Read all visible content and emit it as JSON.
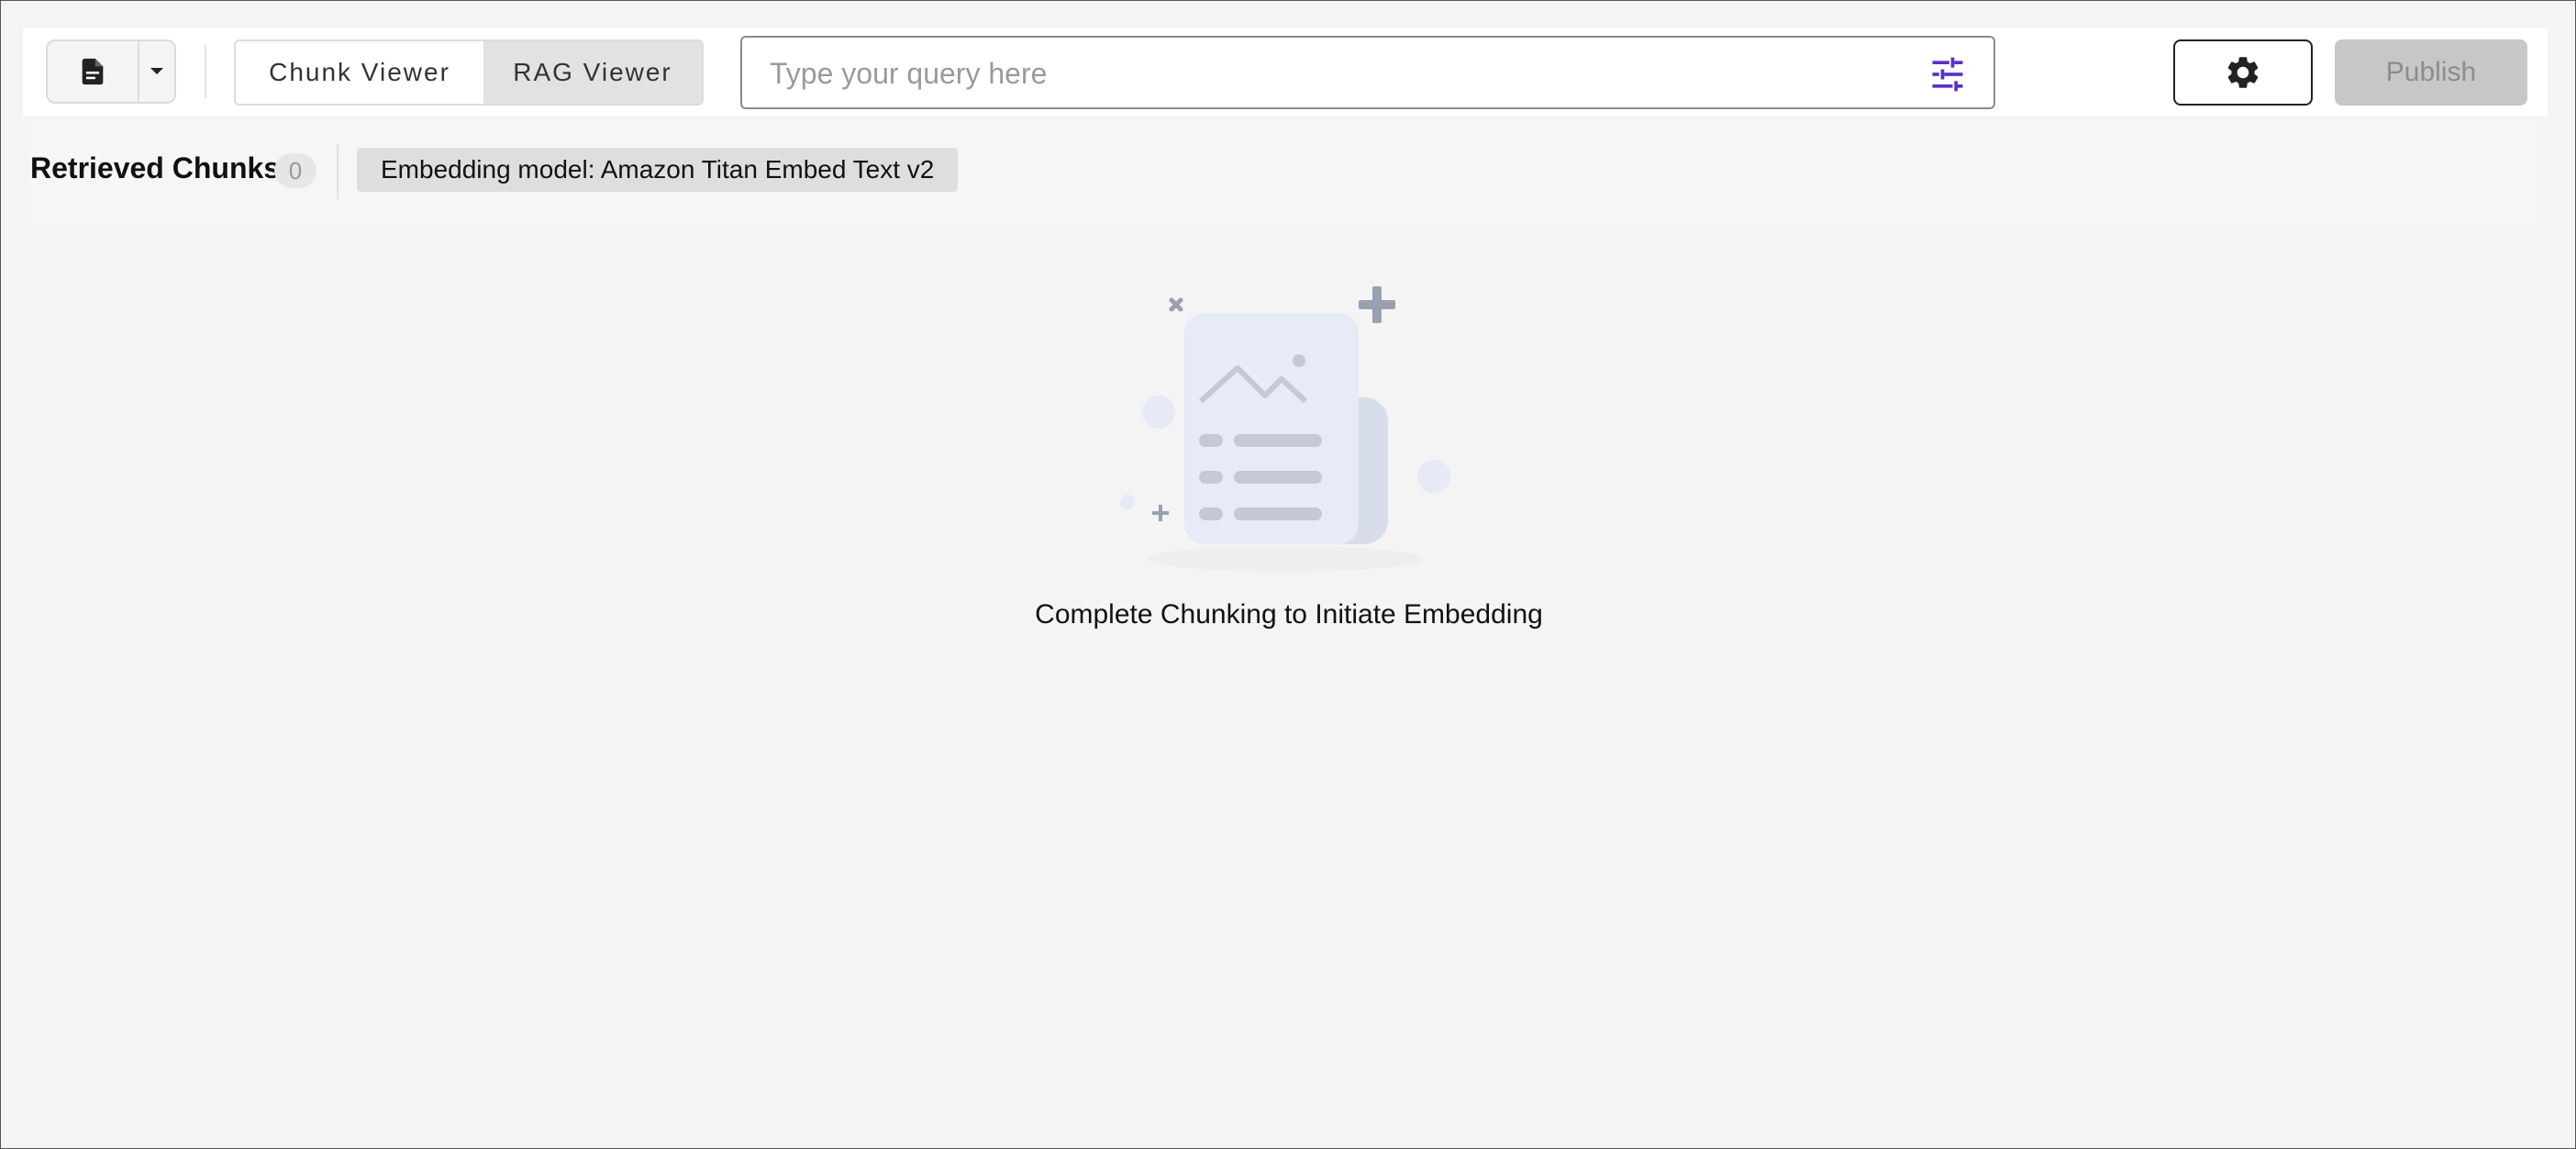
{
  "toolbar": {
    "document_icon": "document-icon",
    "dropdown_icon": "caret-down-icon",
    "tabs": [
      {
        "label": "Chunk Viewer",
        "active": false
      },
      {
        "label": "RAG Viewer",
        "active": true
      }
    ],
    "query": {
      "placeholder": "Type your query here",
      "value": "",
      "filter_icon": "tune-icon",
      "filter_icon_color": "#5b2fc7"
    },
    "settings_icon": "gear-icon",
    "publish_label": "Publish",
    "publish_disabled": true
  },
  "results": {
    "title": "Retrieved Chunks",
    "count": "0",
    "model_label": "Embedding model: Amazon Titan Embed Text v2"
  },
  "empty_state": {
    "illustration": "empty-document-illustration",
    "message": "Complete Chunking to Initiate Embedding"
  }
}
